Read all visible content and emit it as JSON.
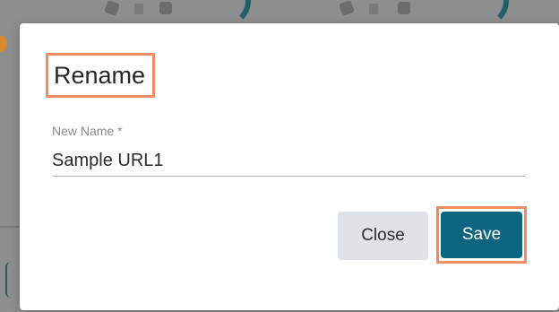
{
  "dialog": {
    "title": "Rename",
    "field_label": "New Name *",
    "field_value": "Sample URL1",
    "close_label": "Close",
    "save_label": "Save"
  },
  "colors": {
    "save_button": "#0e6580",
    "close_button": "#dfe3e8",
    "highlight": "#ee8c66"
  }
}
